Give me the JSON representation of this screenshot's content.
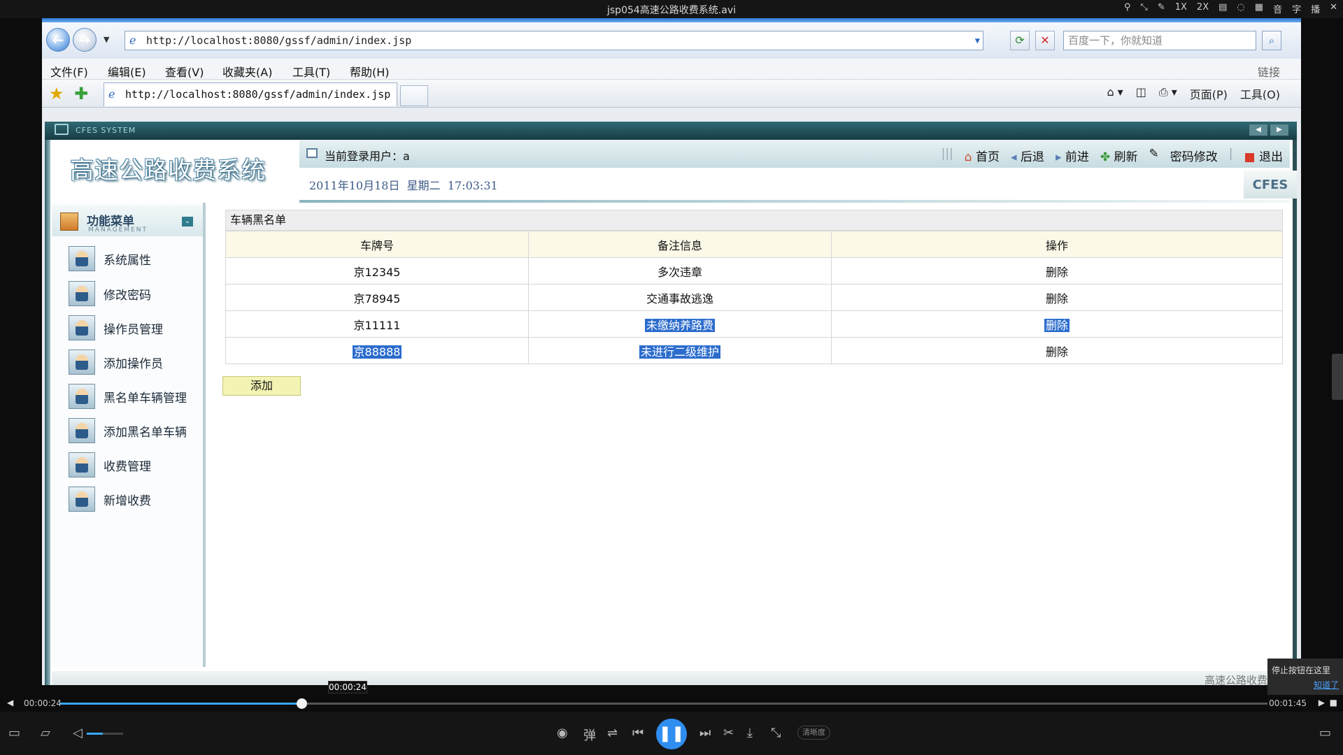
{
  "player": {
    "title": "jsp054高速公路收费系统.avi",
    "ctrl_labels": [
      "1X",
      "2X",
      "字",
      "音",
      "播"
    ],
    "current_time": "00:00:24",
    "total_time": "00:01:45",
    "hover_time": "00:00:24",
    "progress": 0.2,
    "volume": 0.45,
    "quality": "清晰度",
    "tip_text": "停止按钮在这里",
    "tip_link": "知道了"
  },
  "browser": {
    "url": "http://localhost:8080/gssf/admin/index.jsp",
    "search_placeholder": "百度一下，你就知道",
    "menu": [
      "文件(F)",
      "编辑(E)",
      "查看(V)",
      "收藏夹(A)",
      "工具(T)",
      "帮助(H)"
    ],
    "links_label": "链接",
    "tab_title": "http://localhost:8080/gssf/admin/index.jsp",
    "cmd_page": "页面(P)",
    "cmd_tools": "工具(O)"
  },
  "app": {
    "strip_label": "CFES SYSTEM",
    "system_name": "高速公路收费系统",
    "current_user_label": "当前登录用户：a",
    "nav": {
      "home": "首页",
      "back": "后退",
      "forward": "前进",
      "refresh": "刷新",
      "change_password": "密码修改",
      "logout": "退出"
    },
    "date": "2011年10月18日",
    "weekday": "星期二",
    "time": "17:03:31",
    "logo": "CFES",
    "footer_text": "高速公路收费系统"
  },
  "sidebar": {
    "title": "功能菜单",
    "subtitle": "MANAGEMENT",
    "items": [
      {
        "label": "系统属性"
      },
      {
        "label": "修改密码"
      },
      {
        "label": "操作员管理"
      },
      {
        "label": "添加操作员"
      },
      {
        "label": "黑名单车辆管理"
      },
      {
        "label": "添加黑名单车辆"
      },
      {
        "label": "收费管理"
      },
      {
        "label": "新增收费"
      }
    ]
  },
  "blacklist": {
    "title": "车辆黑名单",
    "headers": [
      "车牌号",
      "备注信息",
      "操作"
    ],
    "rows": [
      {
        "plate": "京12345",
        "note": "多次违章",
        "action": "删除"
      },
      {
        "plate": "京78945",
        "note": "交通事故逃逸",
        "action": "删除"
      },
      {
        "plate": "京11111",
        "note": "未缴纳养路费",
        "action": "删除"
      },
      {
        "plate": "京88888",
        "note": "未进行二级维护",
        "action": "删除"
      }
    ],
    "add_label": "添加"
  }
}
